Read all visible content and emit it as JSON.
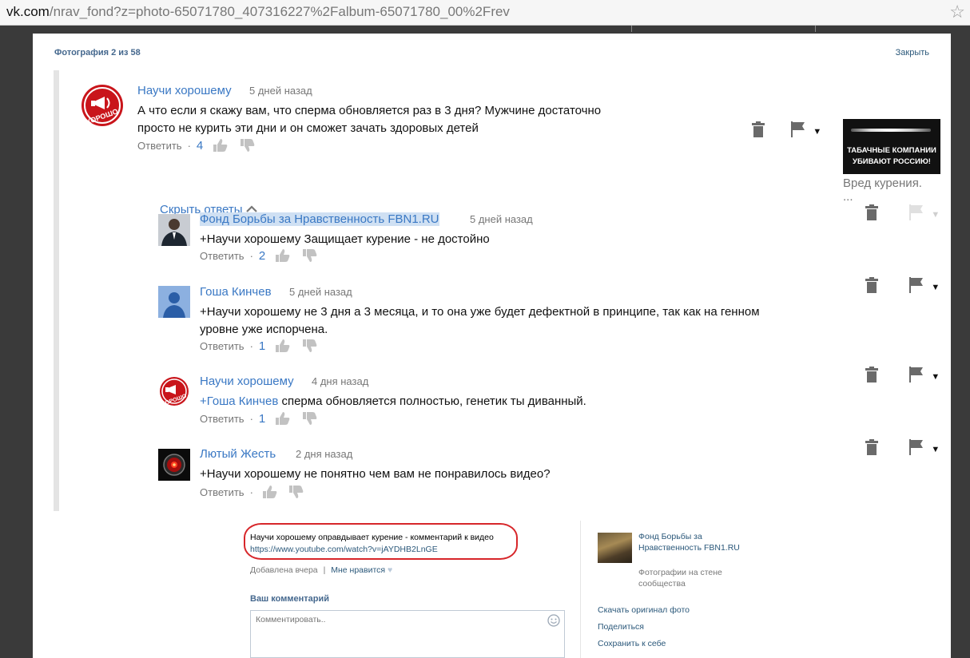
{
  "browser": {
    "url_host": "vk.com",
    "url_path": "/nrav_fond?z=photo-65071780_407316227%2Falbum-65071780_00%2Frev"
  },
  "photo_view": {
    "counter": "Фотография 2 из 58",
    "close_label": "Закрыть"
  },
  "youtube": {
    "top_comment": {
      "author": "Научи хорошему",
      "time": "5 дней назад",
      "text_line1": "А что если я скажу вам, что сперма обновляется раз в 3 дня? Мужчине достаточно",
      "text_line2": "просто не курить эти дни и он сможет зачать здоровых детей",
      "reply": "Ответить",
      "likes": "4"
    },
    "hide_replies": "Скрыть ответы",
    "promo": {
      "line1": "ТАБАЧНЫЕ КОМПАНИИ",
      "line2": "УБИВАЮТ РОССИЮ!",
      "caption": "Вред курения. ..."
    },
    "replies": [
      {
        "author": "Фонд Борьбы за Нравственность FBN1.RU",
        "time": "5 дней назад",
        "text": "+Научи хорошему Защищает курение - не достойно",
        "reply": "Ответить",
        "likes": "2"
      },
      {
        "author": "Гоша Кинчев",
        "time": "5 дней назад",
        "text_line1": "+Научи хорошему не 3 дня а 3 месяца, и то она уже будет дефектной в принципе, так как на генном",
        "text_line2": "уровне уже испорчена.",
        "reply": "Ответить",
        "likes": "1"
      },
      {
        "author": "Научи хорошему",
        "time": "4 дня назад",
        "mention": "+Гоша Кинчев",
        "text": " сперма обновляется полностью, генетик ты диванный.",
        "reply": "Ответить",
        "likes": "1"
      },
      {
        "author": "Лютый Жесть",
        "time": "2 дня назад",
        "text": "+Научи хорошему не понятно чем вам не понравилось видео?",
        "reply": "Ответить"
      }
    ],
    "icons": [
      "trash-icon",
      "flag-icon",
      "dropdown-icon",
      "thumbs-up-icon",
      "thumbs-down-icon",
      "chevron-up-icon"
    ]
  },
  "photo_info": {
    "description": "Научи хорошему оправдывает курение - комментарий к видео",
    "link": "https://www.youtube.com/watch?v=jAYDHB2LnGE",
    "added": "Добавлена вчера",
    "separator": "|",
    "like_label": "Мне нравится",
    "comment_label": "Ваш комментарий",
    "comment_placeholder": "Комментировать..",
    "source_name": "Фонд Борьбы за Нравственность FBN1.RU",
    "source_sub": "Фотографии на стене сообщества",
    "actions": [
      "Скачать оригинал фото",
      "Поделиться",
      "Сохранить к себе"
    ]
  },
  "colors": {
    "vk_link": "#2b587a",
    "vk_title": "#45688e",
    "yt_link": "#3a78c4",
    "highlight_circle": "#d7262a"
  }
}
